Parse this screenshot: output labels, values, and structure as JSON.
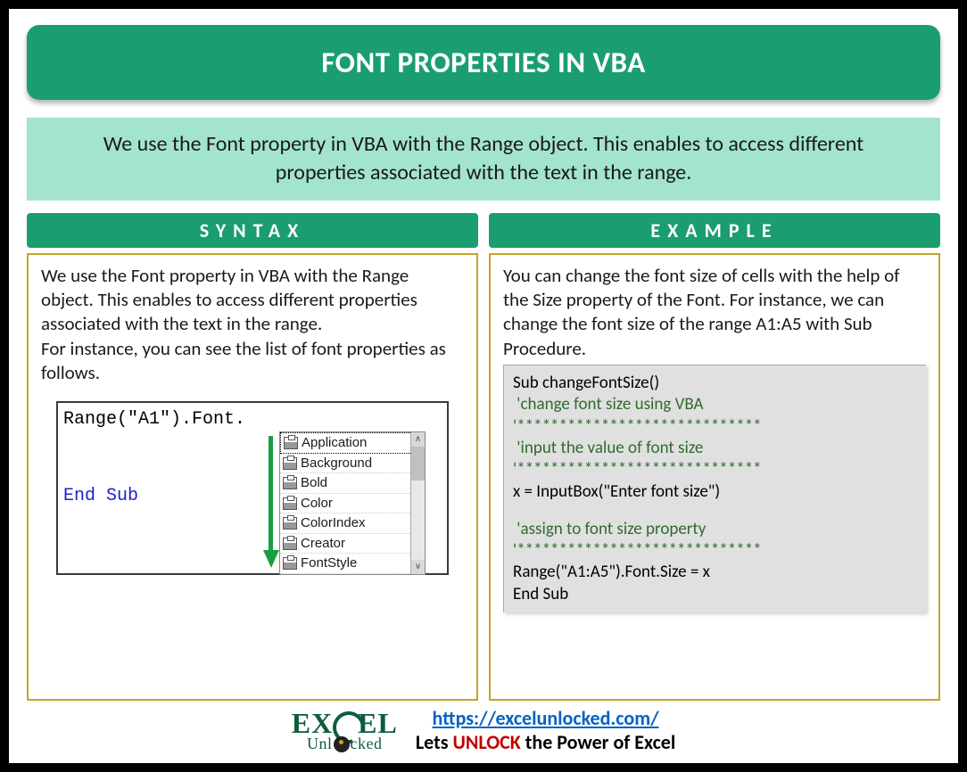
{
  "title": "FONT PROPERTIES IN VBA",
  "intro": "We use the Font property in VBA with the Range object. This enables to access different properties associated with the text in the range.",
  "syntax": {
    "header": "SYNTAX",
    "text1": "We use the Font property in VBA with the Range object. This enables to access different properties associated with the text in the range.",
    "text2": "For instance, you can see the list of font properties as follows.",
    "codeLine1": "Range(\"A1\").Font.",
    "codeLine2": "End Sub",
    "intellisense": [
      "Application",
      "Background",
      "Bold",
      "Color",
      "ColorIndex",
      "Creator",
      "FontStyle"
    ]
  },
  "example": {
    "header": "EXAMPLE",
    "text": "You can change the font size of cells with the help of the Size property of the Font. For instance, we can change the font size of the range A1:A5 with Sub Procedure.",
    "code": {
      "l1": "Sub changeFontSize()",
      "l2": "'change font size using VBA",
      "l3": "'*****************************",
      "l4": "'input the value of font size",
      "l5": "'*****************************",
      "l6": "x = InputBox(\"Enter font size\")",
      "l7": "'assign to font size property",
      "l8": "'*****************************",
      "l9": "Range(\"A1:A5\").Font.Size = x",
      "l10": "End Sub"
    }
  },
  "footer": {
    "logoTop1": "EX",
    "logoTop2": "EL",
    "logoBot1": "Unl",
    "logoBot2": "cked",
    "link": "https://excelunlocked.com/",
    "slogan1": "Lets ",
    "sloganUnlock": "UNLOCK",
    "slogan2": " the Power of Excel"
  }
}
